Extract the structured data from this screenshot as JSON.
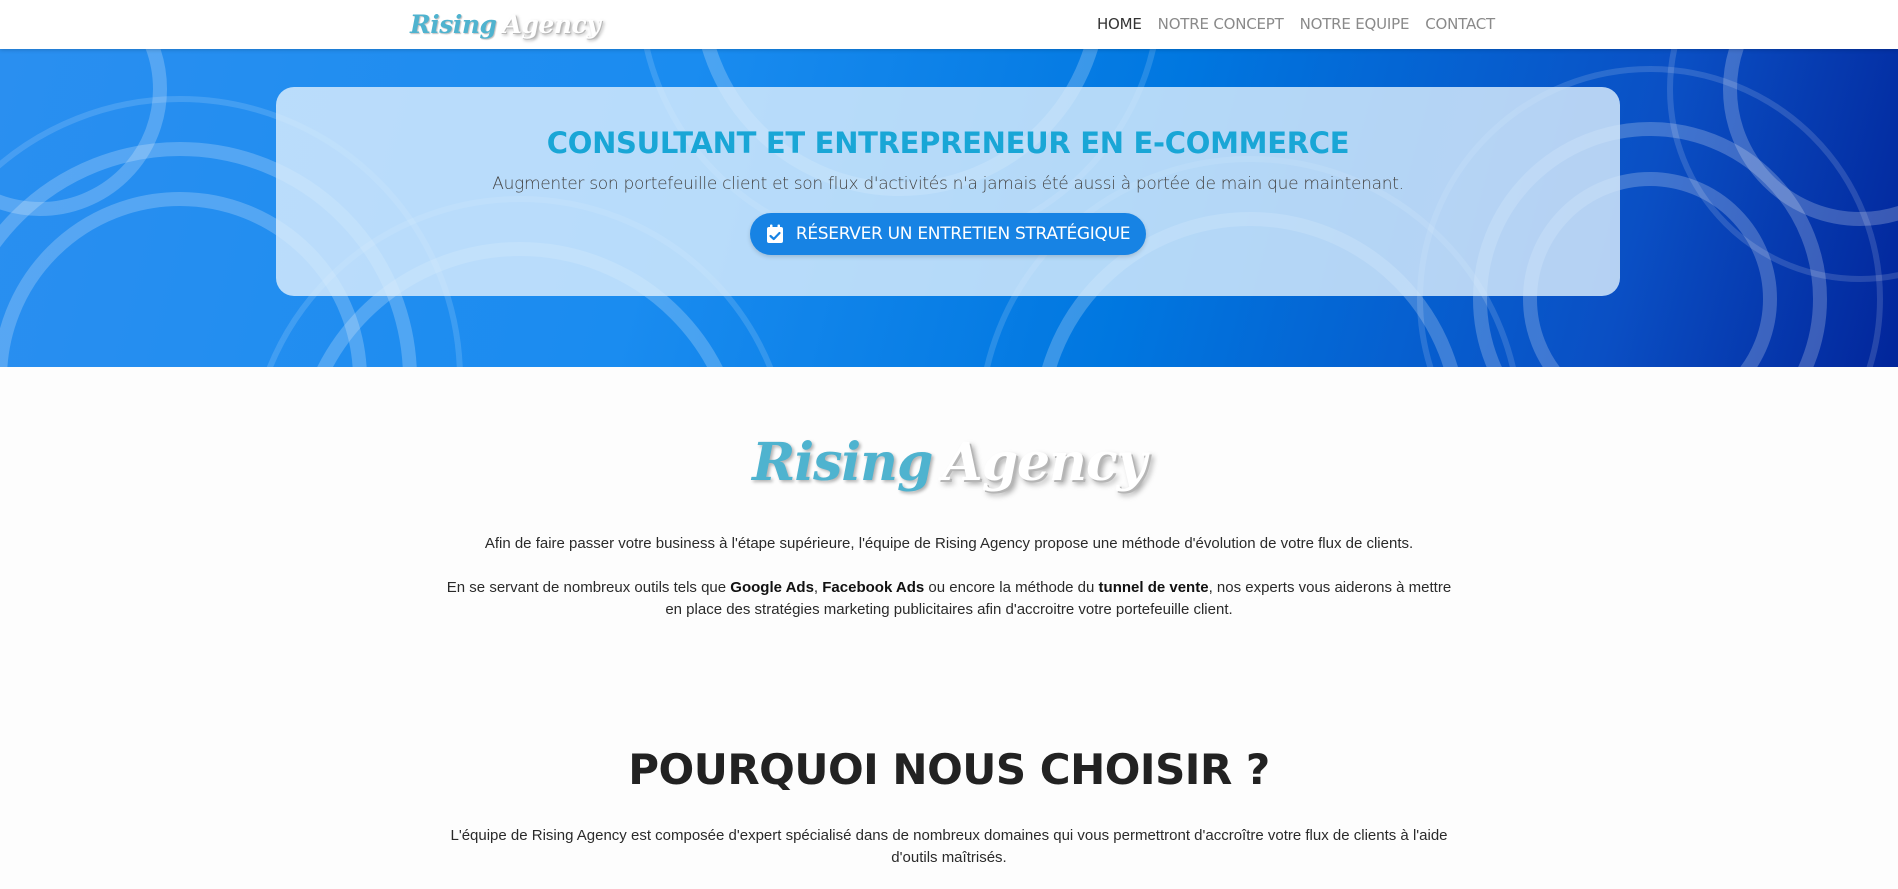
{
  "nav": {
    "logo_part1": "Rising",
    "logo_part2": "Agency",
    "links": [
      {
        "label": "HOME",
        "active": true
      },
      {
        "label": "NOTRE CONCEPT",
        "active": false
      },
      {
        "label": "NOTRE EQUIPE",
        "active": false
      },
      {
        "label": "CONTACT",
        "active": false
      }
    ]
  },
  "hero": {
    "title": "CONSULTANT ET ENTREPRENEUR EN E-COMMERCE",
    "subtitle": "Augmenter son portefeuille client et son flux d'activités n'a jamais été aussi à portée de main que maintenant.",
    "cta_label": "RÉSERVER UN ENTRETIEN STRATÉGIQUE",
    "cta_icon": "calendar-check-icon"
  },
  "about": {
    "logo_part1": "Rising",
    "logo_part2": "Agency",
    "p1": "Afin de faire passer votre business à l'étape supérieure, l'équipe de Rising Agency propose une méthode d'évolution de votre flux de clients.",
    "p2_a": "En se servant de nombreux outils tels que ",
    "p2_b": "Google Ads",
    "p2_c": ", ",
    "p2_d": "Facebook Ads",
    "p2_e": " ou encore la méthode du ",
    "p2_f": "tunnel de vente",
    "p2_g": ", nos experts vous aiderons à mettre en place des stratégies marketing publicitaires afin d'accroitre votre portefeuille client."
  },
  "why": {
    "title": "POURQUOI NOUS CHOISIR ?",
    "text": "L'équipe de Rising Agency est composée d'expert spécialisé dans de nombreux domaines qui vous permettront d'accroître votre flux de clients à l'aide d'outils maîtrisés."
  },
  "colors": {
    "accent": "#19a6d6",
    "cta": "#1783e4",
    "hero_blue": "#0077e0"
  }
}
